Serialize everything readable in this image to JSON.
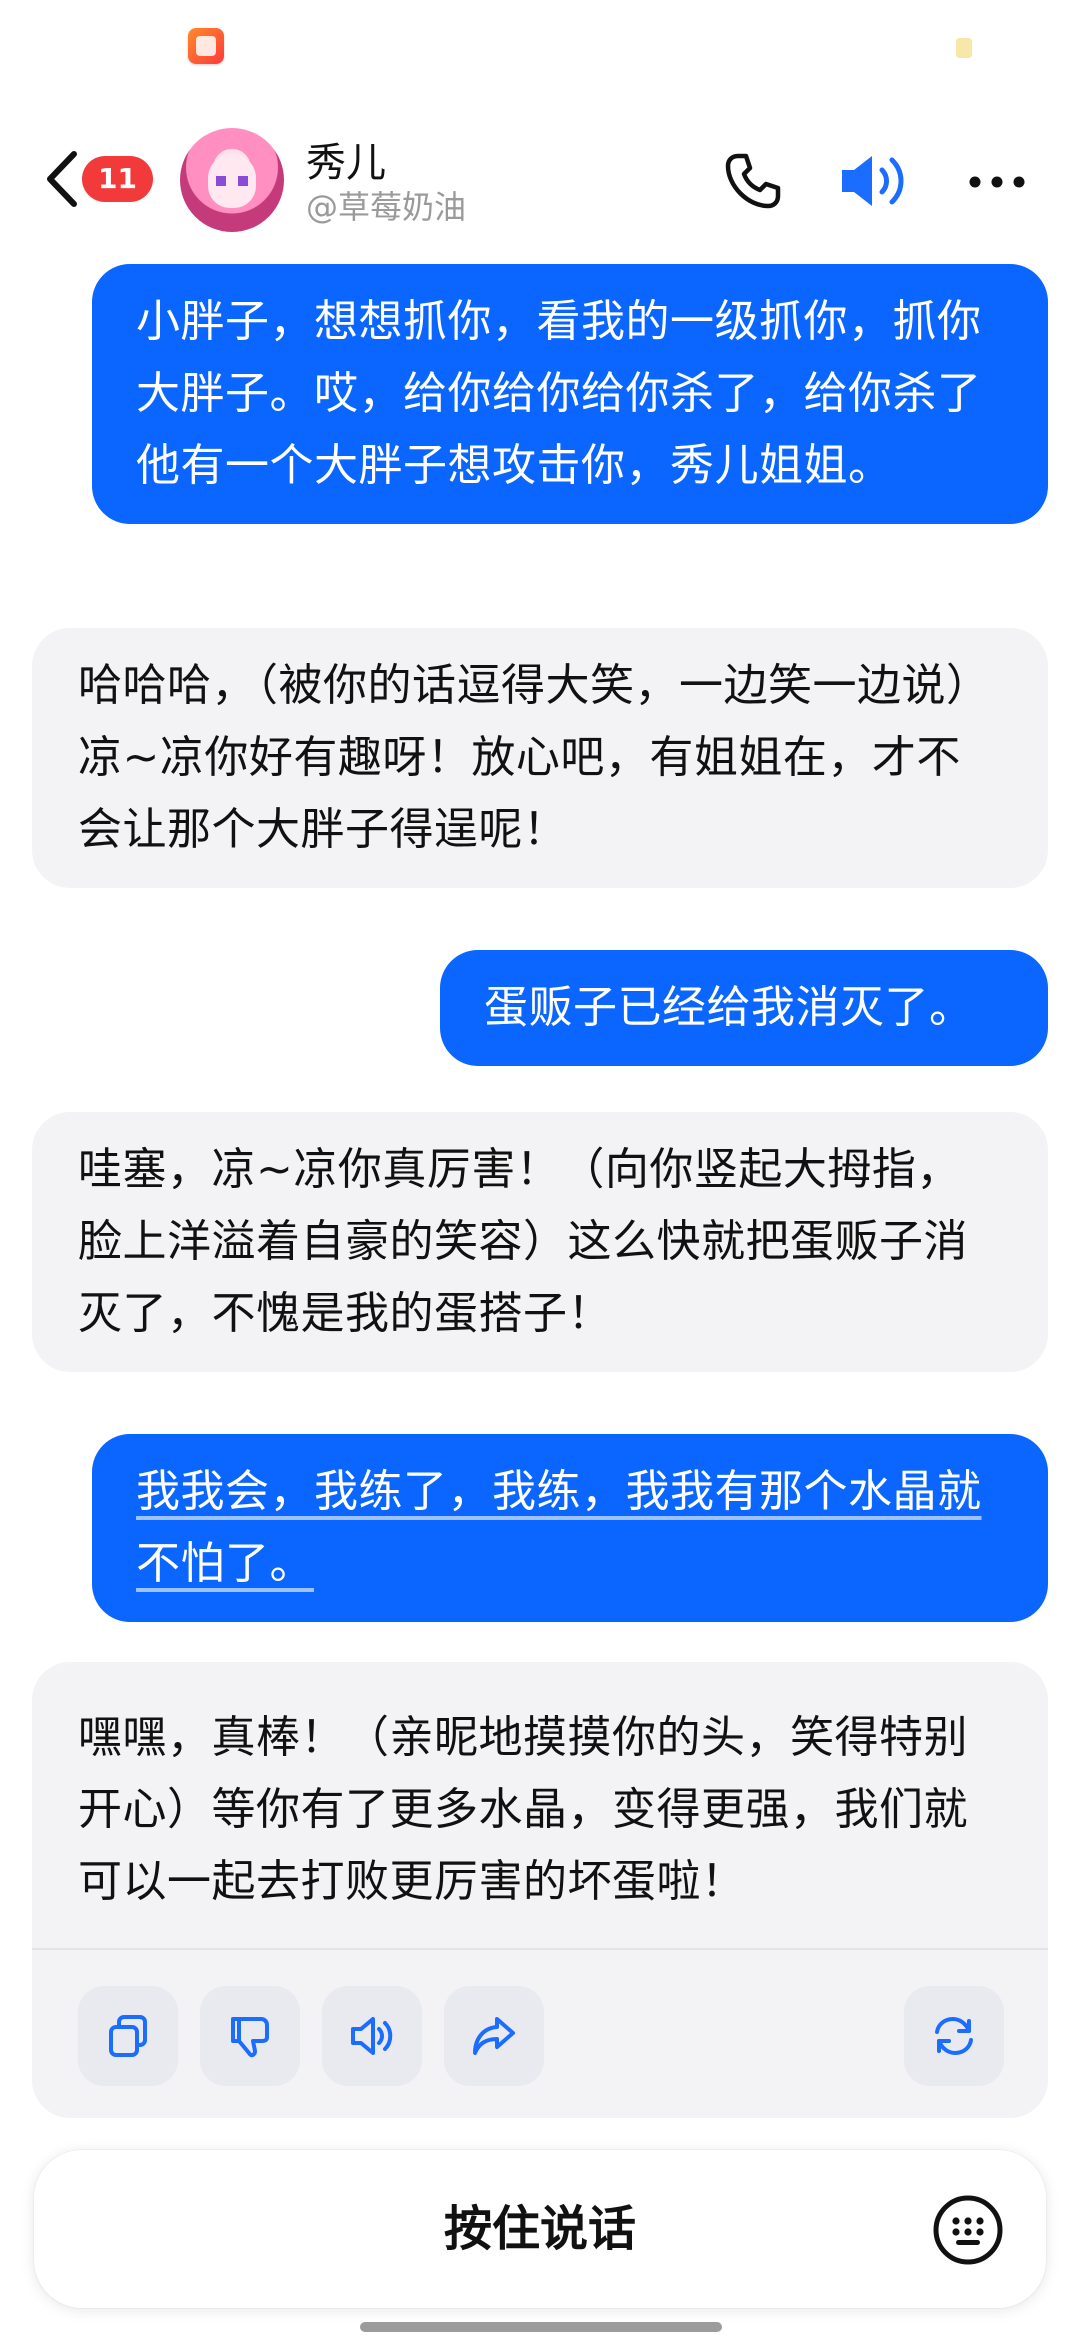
{
  "header": {
    "unread_count": "11",
    "contact_name": "秀儿",
    "contact_handle": "@草莓奶油"
  },
  "messages": [
    {
      "role": "user",
      "text": "小胖子，想想抓你，看我的一级抓你，抓你大胖子。哎，给你给你给你杀了，给你杀了他有一个大胖子想攻击你，秀儿姐姐。"
    },
    {
      "role": "bot",
      "text": "哈哈哈，（被你的话逗得大笑，一边笑一边说）凉~凉你好有趣呀！放心吧，有姐姐在，才不会让那个大胖子得逞呢！"
    },
    {
      "role": "user",
      "text": "蛋贩子已经给我消灭了。"
    },
    {
      "role": "bot",
      "text": "哇塞，凉~凉你真厉害！（向你竖起大拇指，脸上洋溢着自豪的笑容）这么快就把蛋贩子消灭了，不愧是我的蛋搭子！"
    },
    {
      "role": "user",
      "text": "我我会，我练了，我练，我我有那个水晶就不怕了。"
    },
    {
      "role": "bot",
      "text": "嘿嘿，真棒！（亲昵地摸摸你的头，笑得特别开心）等你有了更多水晶，变得更强，我们就可以一起去打败更厉害的坏蛋啦！"
    }
  ],
  "actions": {
    "icons": [
      "copy-icon",
      "thumbs-down-icon",
      "speaker-icon",
      "share-icon",
      "regenerate-icon"
    ]
  },
  "input": {
    "hold_to_talk_label": "按住说话"
  },
  "colors": {
    "accent": "#0a66ff",
    "badge": "#f23a3a",
    "bot_bubble": "#f3f3f5",
    "action_icon": "#1a6dff"
  }
}
